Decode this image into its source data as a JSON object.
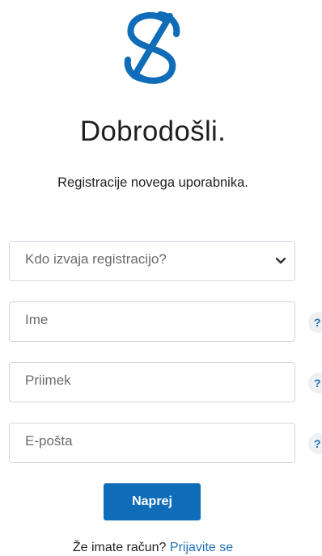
{
  "brand": {
    "logo_icon": "ss-logo-icon",
    "accent_color": "#1f6fb5"
  },
  "heading": {
    "title": "Dobrodošli.",
    "subtitle": "Registracije novega uporabnika."
  },
  "form": {
    "registrant_select": {
      "value": "Kdo izvaja registracijo?",
      "icon": "chevron-down-icon"
    },
    "first_name": {
      "placeholder": "Ime"
    },
    "last_name": {
      "placeholder": "Priimek"
    },
    "email": {
      "placeholder": "E-pošta"
    },
    "help_label": "?",
    "submit_label": "Naprej",
    "submit_color": "#0f6cb8"
  },
  "footer": {
    "prompt": "Že imate račun?",
    "login_link": "Prijavite se"
  }
}
